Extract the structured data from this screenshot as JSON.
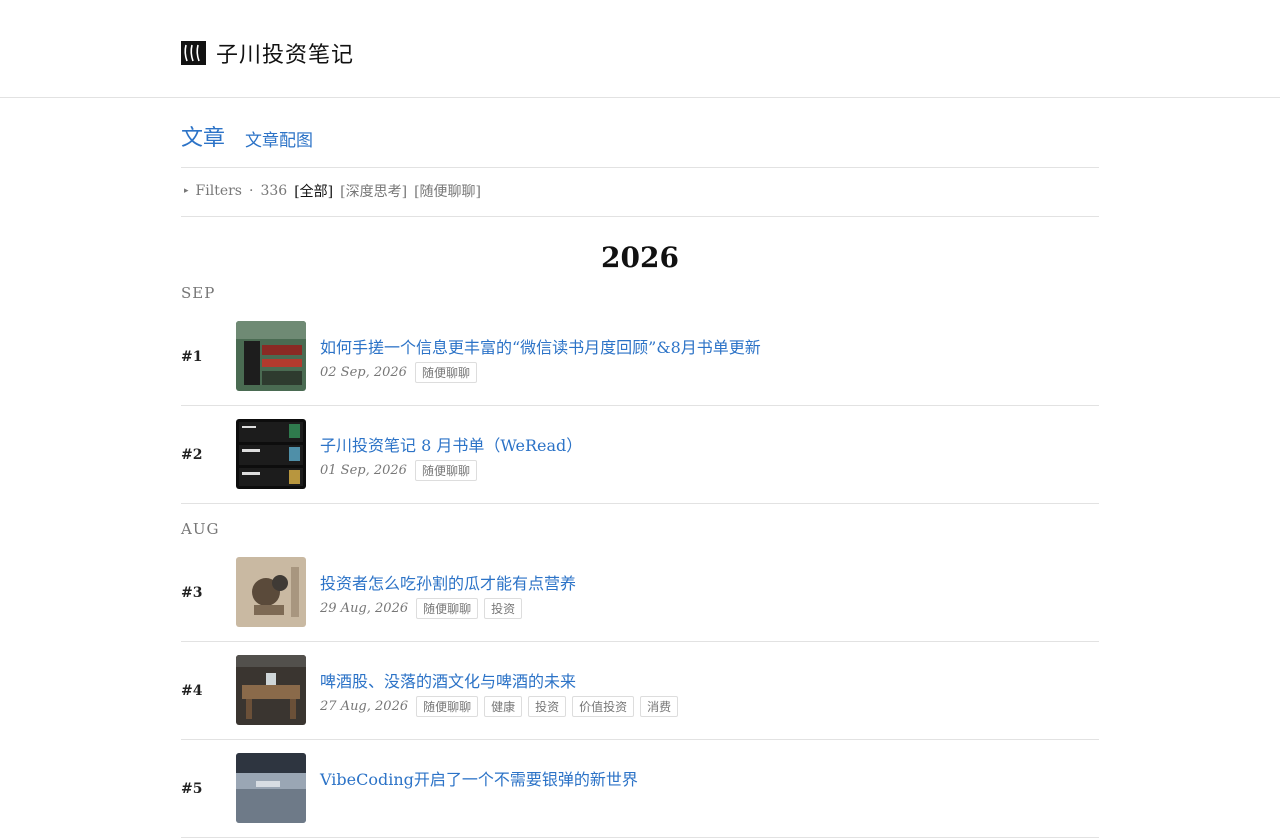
{
  "header": {
    "site_title": "子川投资笔记"
  },
  "tabs": {
    "active": "文章",
    "second": "文章配图"
  },
  "filters": {
    "label": "Filters",
    "dot": "·",
    "count": "336",
    "chips": [
      "[全部]",
      "[深度思考]",
      "[随便聊聊]"
    ]
  },
  "year": "2026",
  "months": [
    "SEP",
    "AUG"
  ],
  "posts": [
    {
      "num": "#1",
      "title": "如何手搓一个信息更丰富的“微信读书月度回顾”&8月书单更新",
      "date": "02 Sep, 2026",
      "tags": [
        "随便聊聊"
      ]
    },
    {
      "num": "#2",
      "title": "子川投资笔记 8 月书单（WeRead）",
      "date": "01 Sep, 2026",
      "tags": [
        "随便聊聊"
      ]
    },
    {
      "num": "#3",
      "title": "投资者怎么吃孙割的瓜才能有点营养",
      "date": "29 Aug, 2026",
      "tags": [
        "随便聊聊",
        "投资"
      ]
    },
    {
      "num": "#4",
      "title": "啤酒股、没落的酒文化与啤酒的未来",
      "date": "27 Aug, 2026",
      "tags": [
        "随便聊聊",
        "健康",
        "投资",
        "价值投资",
        "消费"
      ]
    },
    {
      "num": "#5",
      "title": "VibeCoding开启了一个不需要银弹的新世界",
      "date": "",
      "tags": []
    }
  ],
  "colors": {
    "link": "#2c73c7",
    "muted": "#777777",
    "border": "#e2e2e2"
  }
}
